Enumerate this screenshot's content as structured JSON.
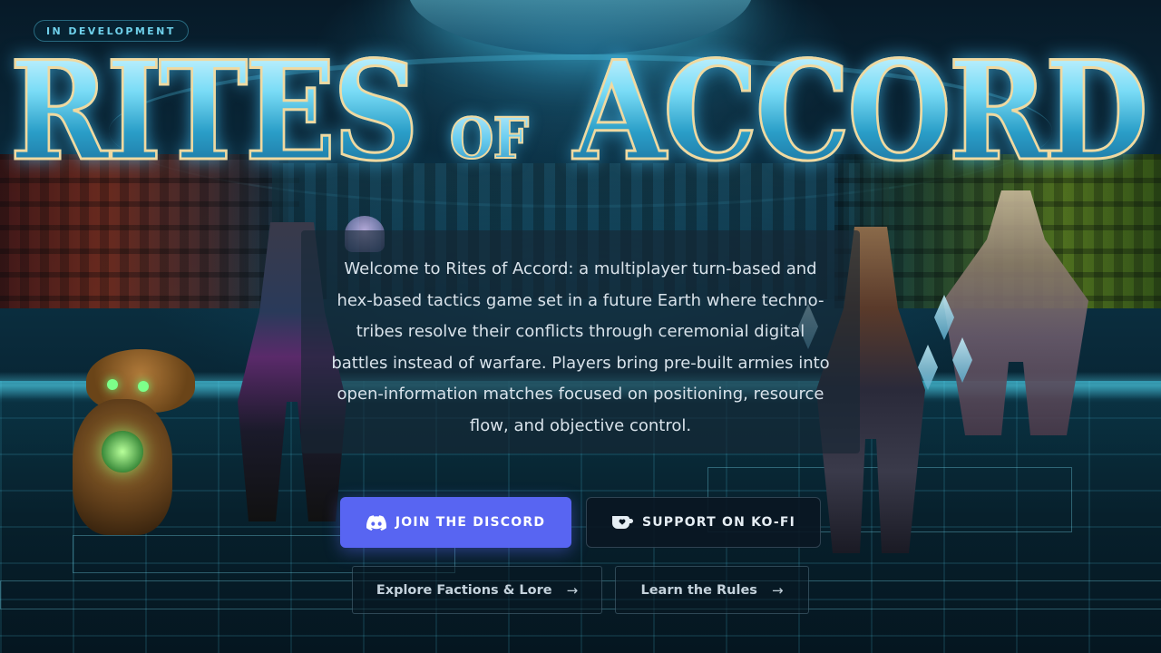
{
  "status_badge": "IN DEVELOPMENT",
  "logo": {
    "word1": "Rites",
    "word2": "of",
    "word3": "Accord"
  },
  "intro_text": "Welcome to Rites of Accord: a multiplayer turn-based and hex-based tactics game set in a future Earth where techno-tribes resolve their conflicts through ceremonial digital battles instead of warfare. Players bring pre-built armies into open-information matches focused on positioning, resource flow, and objective control.",
  "buttons": {
    "discord": {
      "label": "JOIN THE DISCORD",
      "icon": "discord-icon"
    },
    "kofi": {
      "label": "SUPPORT ON KO-FI",
      "icon": "ko-fi-cup-icon"
    },
    "lore": {
      "label": "Explore Factions & Lore",
      "arrow": "→"
    },
    "rules": {
      "label": "Learn the Rules",
      "arrow": "→"
    }
  },
  "colors": {
    "discord": "#5865f2",
    "accent_cyan": "#5fd2f0",
    "logo_trim": "#f0d9a0"
  }
}
